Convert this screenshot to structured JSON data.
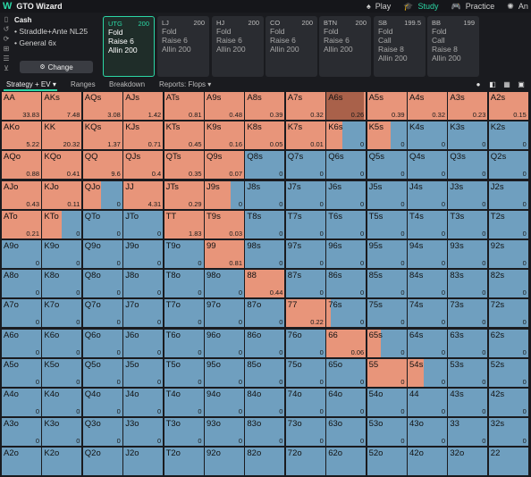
{
  "app": {
    "title": "GTO Wizard",
    "logo_icon": "wizard-logo-icon",
    "accent_color": "#2bd7a5",
    "colors": {
      "fold": "#6f9fbf",
      "raise": "#e8957a",
      "allin": "#a9614a"
    }
  },
  "nav": {
    "items": [
      {
        "label": "Play",
        "icon": "spade-icon",
        "active": false
      },
      {
        "label": "Study",
        "icon": "study-hat-icon",
        "active": true
      },
      {
        "label": "Practice",
        "icon": "gamepad-icon",
        "active": false
      },
      {
        "label": "An",
        "icon": "analyze-icon",
        "active": false
      }
    ]
  },
  "game": {
    "type": "Cash",
    "details": [
      "Straddle+Ante NL25",
      "General 6x"
    ],
    "change_label": "Change"
  },
  "positions": [
    {
      "name": "UTG",
      "stack": "200",
      "actions": [
        "Fold",
        "Raise 6",
        "Allin 200"
      ],
      "active": true
    },
    {
      "name": "LJ",
      "stack": "200",
      "actions": [
        "Fold",
        "Raise 6",
        "Allin 200"
      ],
      "active": false
    },
    {
      "name": "HJ",
      "stack": "200",
      "actions": [
        "Fold",
        "Raise 6",
        "Allin 200"
      ],
      "active": false
    },
    {
      "name": "CO",
      "stack": "200",
      "actions": [
        "Fold",
        "Raise 6",
        "Allin 200"
      ],
      "active": false
    },
    {
      "name": "BTN",
      "stack": "200",
      "actions": [
        "Fold",
        "Raise 6",
        "Allin 200"
      ],
      "active": false
    },
    {
      "name": "SB",
      "stack": "199.5",
      "actions": [
        "Fold",
        "Call",
        "Raise 8",
        "Allin 200"
      ],
      "active": false
    },
    {
      "name": "BB",
      "stack": "199",
      "actions": [
        "Fold",
        "Call",
        "Raise 8",
        "Allin 200"
      ],
      "active": false
    }
  ],
  "toolbar": {
    "strategy_label": "Strategy + EV",
    "ranges_label": "Ranges",
    "breakdown_label": "Breakdown",
    "reports_label": "Reports: Flops"
  },
  "grid": [
    [
      {
        "h": "AA",
        "ev": "33.83",
        "r": 1,
        "a": 0
      },
      {
        "h": "AKs",
        "ev": "7.48",
        "r": 1,
        "a": 0
      },
      {
        "h": "AQs",
        "ev": "3.08",
        "r": 1,
        "a": 0
      },
      {
        "h": "AJs",
        "ev": "1.42",
        "r": 1,
        "a": 0
      },
      {
        "h": "ATs",
        "ev": "0.81",
        "r": 1,
        "a": 0
      },
      {
        "h": "A9s",
        "ev": "0.48",
        "r": 1,
        "a": 0
      },
      {
        "h": "A8s",
        "ev": "0.39",
        "r": 1,
        "a": 0
      },
      {
        "h": "A7s",
        "ev": "0.32",
        "r": 1,
        "a": 0
      },
      {
        "h": "A6s",
        "ev": "0.26",
        "r": 1,
        "a": 0.95
      },
      {
        "h": "A5s",
        "ev": "0.39",
        "r": 1,
        "a": 0
      },
      {
        "h": "A4s",
        "ev": "0.32",
        "r": 1,
        "a": 0
      },
      {
        "h": "A3s",
        "ev": "0.23",
        "r": 1,
        "a": 0
      },
      {
        "h": "A2s",
        "ev": "0.15",
        "r": 1,
        "a": 0
      }
    ],
    [
      {
        "h": "AKo",
        "ev": "5.22",
        "r": 1,
        "a": 0
      },
      {
        "h": "KK",
        "ev": "20.32",
        "r": 1,
        "a": 0
      },
      {
        "h": "KQs",
        "ev": "1.37",
        "r": 1,
        "a": 0
      },
      {
        "h": "KJs",
        "ev": "0.71",
        "r": 1,
        "a": 0
      },
      {
        "h": "KTs",
        "ev": "0.45",
        "r": 1,
        "a": 0
      },
      {
        "h": "K9s",
        "ev": "0.16",
        "r": 1,
        "a": 0
      },
      {
        "h": "K8s",
        "ev": "0.05",
        "r": 1,
        "a": 0
      },
      {
        "h": "K7s",
        "ev": "0.01",
        "r": 1,
        "a": 0
      },
      {
        "h": "K6s",
        "ev": "0",
        "r": 0.4,
        "a": 0
      },
      {
        "h": "K5s",
        "ev": "0",
        "r": 0.6,
        "a": 0
      },
      {
        "h": "K4s",
        "ev": "0",
        "r": 0,
        "a": 0
      },
      {
        "h": "K3s",
        "ev": "0",
        "r": 0,
        "a": 0
      },
      {
        "h": "K2s",
        "ev": "0",
        "r": 0,
        "a": 0
      }
    ],
    [
      {
        "h": "AQo",
        "ev": "0.88",
        "r": 1,
        "a": 0
      },
      {
        "h": "KQo",
        "ev": "0.41",
        "r": 1,
        "a": 0
      },
      {
        "h": "QQ",
        "ev": "9.6",
        "r": 1,
        "a": 0
      },
      {
        "h": "QJs",
        "ev": "0.4",
        "r": 1,
        "a": 0
      },
      {
        "h": "QTs",
        "ev": "0.35",
        "r": 1,
        "a": 0
      },
      {
        "h": "Q9s",
        "ev": "0.07",
        "r": 1,
        "a": 0
      },
      {
        "h": "Q8s",
        "ev": "0",
        "r": 0,
        "a": 0
      },
      {
        "h": "Q7s",
        "ev": "0",
        "r": 0,
        "a": 0
      },
      {
        "h": "Q6s",
        "ev": "0",
        "r": 0,
        "a": 0
      },
      {
        "h": "Q5s",
        "ev": "0",
        "r": 0,
        "a": 0
      },
      {
        "h": "Q4s",
        "ev": "0",
        "r": 0,
        "a": 0
      },
      {
        "h": "Q3s",
        "ev": "0",
        "r": 0,
        "a": 0
      },
      {
        "h": "Q2s",
        "ev": "0",
        "r": 0,
        "a": 0
      }
    ],
    [
      {
        "h": "AJo",
        "ev": "0.43",
        "r": 1,
        "a": 0
      },
      {
        "h": "KJo",
        "ev": "0.11",
        "r": 1,
        "a": 0
      },
      {
        "h": "QJo",
        "ev": "0",
        "r": 0.45,
        "a": 0
      },
      {
        "h": "JJ",
        "ev": "4.31",
        "r": 1,
        "a": 0
      },
      {
        "h": "JTs",
        "ev": "0.29",
        "r": 1,
        "a": 0
      },
      {
        "h": "J9s",
        "ev": "0",
        "r": 0.65,
        "a": 0
      },
      {
        "h": "J8s",
        "ev": "0",
        "r": 0,
        "a": 0
      },
      {
        "h": "J7s",
        "ev": "0",
        "r": 0,
        "a": 0
      },
      {
        "h": "J6s",
        "ev": "0",
        "r": 0,
        "a": 0
      },
      {
        "h": "J5s",
        "ev": "0",
        "r": 0,
        "a": 0
      },
      {
        "h": "J4s",
        "ev": "0",
        "r": 0,
        "a": 0
      },
      {
        "h": "J3s",
        "ev": "0",
        "r": 0,
        "a": 0
      },
      {
        "h": "J2s",
        "ev": "0",
        "r": 0,
        "a": 0
      }
    ],
    [
      {
        "h": "ATo",
        "ev": "0.21",
        "r": 1,
        "a": 0
      },
      {
        "h": "KTo",
        "ev": "0",
        "r": 0.5,
        "a": 0
      },
      {
        "h": "QTo",
        "ev": "0",
        "r": 0,
        "a": 0
      },
      {
        "h": "JTo",
        "ev": "0",
        "r": 0,
        "a": 0
      },
      {
        "h": "TT",
        "ev": "1.83",
        "r": 1,
        "a": 0
      },
      {
        "h": "T9s",
        "ev": "0.03",
        "r": 1,
        "a": 0
      },
      {
        "h": "T8s",
        "ev": "0",
        "r": 0,
        "a": 0
      },
      {
        "h": "T7s",
        "ev": "0",
        "r": 0,
        "a": 0
      },
      {
        "h": "T6s",
        "ev": "0",
        "r": 0,
        "a": 0
      },
      {
        "h": "T5s",
        "ev": "0",
        "r": 0,
        "a": 0
      },
      {
        "h": "T4s",
        "ev": "0",
        "r": 0,
        "a": 0
      },
      {
        "h": "T3s",
        "ev": "0",
        "r": 0,
        "a": 0
      },
      {
        "h": "T2s",
        "ev": "0",
        "r": 0,
        "a": 0
      }
    ],
    [
      {
        "h": "A9o",
        "ev": "0",
        "r": 0,
        "a": 0
      },
      {
        "h": "K9o",
        "ev": "0",
        "r": 0,
        "a": 0
      },
      {
        "h": "Q9o",
        "ev": "0",
        "r": 0,
        "a": 0
      },
      {
        "h": "J9o",
        "ev": "0",
        "r": 0,
        "a": 0
      },
      {
        "h": "T9o",
        "ev": "0",
        "r": 0,
        "a": 0
      },
      {
        "h": "99",
        "ev": "0.81",
        "r": 1,
        "a": 0
      },
      {
        "h": "98s",
        "ev": "0",
        "r": 0,
        "a": 0
      },
      {
        "h": "97s",
        "ev": "0",
        "r": 0,
        "a": 0
      },
      {
        "h": "96s",
        "ev": "0",
        "r": 0,
        "a": 0
      },
      {
        "h": "95s",
        "ev": "0",
        "r": 0,
        "a": 0
      },
      {
        "h": "94s",
        "ev": "0",
        "r": 0,
        "a": 0
      },
      {
        "h": "93s",
        "ev": "0",
        "r": 0,
        "a": 0
      },
      {
        "h": "92s",
        "ev": "0",
        "r": 0,
        "a": 0
      }
    ],
    [
      {
        "h": "A8o",
        "ev": "0",
        "r": 0,
        "a": 0
      },
      {
        "h": "K8o",
        "ev": "0",
        "r": 0,
        "a": 0
      },
      {
        "h": "Q8o",
        "ev": "0",
        "r": 0,
        "a": 0
      },
      {
        "h": "J8o",
        "ev": "0",
        "r": 0,
        "a": 0
      },
      {
        "h": "T8o",
        "ev": "0",
        "r": 0,
        "a": 0
      },
      {
        "h": "98o",
        "ev": "0",
        "r": 0,
        "a": 0
      },
      {
        "h": "88",
        "ev": "0.44",
        "r": 1,
        "a": 0
      },
      {
        "h": "87s",
        "ev": "0",
        "r": 0,
        "a": 0
      },
      {
        "h": "86s",
        "ev": "0",
        "r": 0,
        "a": 0
      },
      {
        "h": "85s",
        "ev": "0",
        "r": 0,
        "a": 0
      },
      {
        "h": "84s",
        "ev": "0",
        "r": 0,
        "a": 0
      },
      {
        "h": "83s",
        "ev": "0",
        "r": 0,
        "a": 0
      },
      {
        "h": "82s",
        "ev": "0",
        "r": 0,
        "a": 0
      }
    ],
    [
      {
        "h": "A7o",
        "ev": "0",
        "r": 0,
        "a": 0
      },
      {
        "h": "K7o",
        "ev": "0",
        "r": 0,
        "a": 0
      },
      {
        "h": "Q7o",
        "ev": "0",
        "r": 0,
        "a": 0
      },
      {
        "h": "J7o",
        "ev": "0",
        "r": 0,
        "a": 0
      },
      {
        "h": "T7o",
        "ev": "0",
        "r": 0,
        "a": 0
      },
      {
        "h": "97o",
        "ev": "0",
        "r": 0,
        "a": 0
      },
      {
        "h": "87o",
        "ev": "0",
        "r": 0,
        "a": 0
      },
      {
        "h": "77",
        "ev": "0.22",
        "r": 1,
        "a": 0
      },
      {
        "h": "76s",
        "ev": "0",
        "r": 0.1,
        "a": 0
      },
      {
        "h": "75s",
        "ev": "0",
        "r": 0,
        "a": 0
      },
      {
        "h": "74s",
        "ev": "0",
        "r": 0,
        "a": 0
      },
      {
        "h": "73s",
        "ev": "0",
        "r": 0,
        "a": 0
      },
      {
        "h": "72s",
        "ev": "0",
        "r": 0,
        "a": 0
      }
    ],
    [
      {
        "h": "A6o",
        "ev": "0",
        "r": 0,
        "a": 0
      },
      {
        "h": "K6o",
        "ev": "0",
        "r": 0,
        "a": 0
      },
      {
        "h": "Q6o",
        "ev": "0",
        "r": 0,
        "a": 0
      },
      {
        "h": "J6o",
        "ev": "0",
        "r": 0,
        "a": 0
      },
      {
        "h": "T6o",
        "ev": "0",
        "r": 0,
        "a": 0
      },
      {
        "h": "96o",
        "ev": "0",
        "r": 0,
        "a": 0
      },
      {
        "h": "86o",
        "ev": "0",
        "r": 0,
        "a": 0
      },
      {
        "h": "76o",
        "ev": "0",
        "r": 0,
        "a": 0
      },
      {
        "h": "66",
        "ev": "0.06",
        "r": 1,
        "a": 0
      },
      {
        "h": "65s",
        "ev": "0",
        "r": 0.35,
        "a": 0
      },
      {
        "h": "64s",
        "ev": "0",
        "r": 0,
        "a": 0
      },
      {
        "h": "63s",
        "ev": "0",
        "r": 0,
        "a": 0
      },
      {
        "h": "62s",
        "ev": "0",
        "r": 0,
        "a": 0
      }
    ],
    [
      {
        "h": "A5o",
        "ev": "0",
        "r": 0,
        "a": 0
      },
      {
        "h": "K5o",
        "ev": "0",
        "r": 0,
        "a": 0
      },
      {
        "h": "Q5o",
        "ev": "0",
        "r": 0,
        "a": 0
      },
      {
        "h": "J5o",
        "ev": "0",
        "r": 0,
        "a": 0
      },
      {
        "h": "T5o",
        "ev": "0",
        "r": 0,
        "a": 0
      },
      {
        "h": "95o",
        "ev": "0",
        "r": 0,
        "a": 0
      },
      {
        "h": "85o",
        "ev": "0",
        "r": 0,
        "a": 0
      },
      {
        "h": "75o",
        "ev": "0",
        "r": 0,
        "a": 0
      },
      {
        "h": "65o",
        "ev": "0",
        "r": 0,
        "a": 0
      },
      {
        "h": "55",
        "ev": "0",
        "r": 1,
        "a": 0
      },
      {
        "h": "54s",
        "ev": "0",
        "r": 0.4,
        "a": 0
      },
      {
        "h": "53s",
        "ev": "0",
        "r": 0,
        "a": 0
      },
      {
        "h": "52s",
        "ev": "0",
        "r": 0,
        "a": 0
      }
    ],
    [
      {
        "h": "A4o",
        "ev": "0",
        "r": 0,
        "a": 0
      },
      {
        "h": "K4o",
        "ev": "0",
        "r": 0,
        "a": 0
      },
      {
        "h": "Q4o",
        "ev": "0",
        "r": 0,
        "a": 0
      },
      {
        "h": "J4o",
        "ev": "0",
        "r": 0,
        "a": 0
      },
      {
        "h": "T4o",
        "ev": "0",
        "r": 0,
        "a": 0
      },
      {
        "h": "94o",
        "ev": "0",
        "r": 0,
        "a": 0
      },
      {
        "h": "84o",
        "ev": "0",
        "r": 0,
        "a": 0
      },
      {
        "h": "74o",
        "ev": "0",
        "r": 0,
        "a": 0
      },
      {
        "h": "64o",
        "ev": "0",
        "r": 0,
        "a": 0
      },
      {
        "h": "54o",
        "ev": "0",
        "r": 0,
        "a": 0
      },
      {
        "h": "44",
        "ev": "0",
        "r": 0,
        "a": 0
      },
      {
        "h": "43s",
        "ev": "0",
        "r": 0,
        "a": 0
      },
      {
        "h": "42s",
        "ev": "0",
        "r": 0,
        "a": 0
      }
    ],
    [
      {
        "h": "A3o",
        "ev": "0",
        "r": 0,
        "a": 0
      },
      {
        "h": "K3o",
        "ev": "0",
        "r": 0,
        "a": 0
      },
      {
        "h": "Q3o",
        "ev": "0",
        "r": 0,
        "a": 0
      },
      {
        "h": "J3o",
        "ev": "0",
        "r": 0,
        "a": 0
      },
      {
        "h": "T3o",
        "ev": "0",
        "r": 0,
        "a": 0
      },
      {
        "h": "93o",
        "ev": "0",
        "r": 0,
        "a": 0
      },
      {
        "h": "83o",
        "ev": "0",
        "r": 0,
        "a": 0
      },
      {
        "h": "73o",
        "ev": "0",
        "r": 0,
        "a": 0
      },
      {
        "h": "63o",
        "ev": "0",
        "r": 0,
        "a": 0
      },
      {
        "h": "53o",
        "ev": "0",
        "r": 0,
        "a": 0
      },
      {
        "h": "43o",
        "ev": "0",
        "r": 0,
        "a": 0
      },
      {
        "h": "33",
        "ev": "0",
        "r": 0,
        "a": 0
      },
      {
        "h": "32s",
        "ev": "0",
        "r": 0,
        "a": 0
      }
    ],
    [
      {
        "h": "A2o",
        "ev": "",
        "r": 0,
        "a": 0
      },
      {
        "h": "K2o",
        "ev": "",
        "r": 0,
        "a": 0
      },
      {
        "h": "Q2o",
        "ev": "",
        "r": 0,
        "a": 0
      },
      {
        "h": "J2o",
        "ev": "",
        "r": 0,
        "a": 0
      },
      {
        "h": "T2o",
        "ev": "",
        "r": 0,
        "a": 0
      },
      {
        "h": "92o",
        "ev": "",
        "r": 0,
        "a": 0
      },
      {
        "h": "82o",
        "ev": "",
        "r": 0,
        "a": 0
      },
      {
        "h": "72o",
        "ev": "",
        "r": 0,
        "a": 0
      },
      {
        "h": "62o",
        "ev": "",
        "r": 0,
        "a": 0
      },
      {
        "h": "52o",
        "ev": "",
        "r": 0,
        "a": 0
      },
      {
        "h": "42o",
        "ev": "",
        "r": 0,
        "a": 0
      },
      {
        "h": "32o",
        "ev": "",
        "r": 0,
        "a": 0
      },
      {
        "h": "22",
        "ev": "",
        "r": 0,
        "a": 0
      }
    ]
  ]
}
